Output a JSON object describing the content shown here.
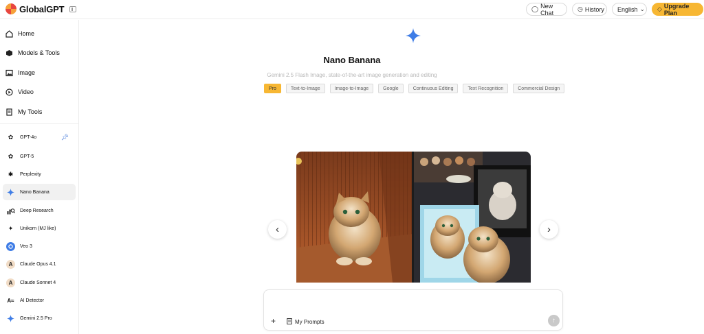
{
  "brand": {
    "name": "GlobalGPT"
  },
  "topbar": {
    "new_chat": "New Chat",
    "history": "History",
    "language": "English",
    "upgrade": "Upgrade Plan"
  },
  "sidebar": {
    "nav": [
      {
        "label": "Home",
        "icon": "home-icon"
      },
      {
        "label": "Models & Tools",
        "icon": "cube-icon"
      },
      {
        "label": "Image",
        "icon": "image-icon"
      },
      {
        "label": "Video",
        "icon": "play-icon"
      },
      {
        "label": "My Tools",
        "icon": "document-icon"
      }
    ],
    "tools": [
      {
        "label": "GPT-4o",
        "icon": "openai-icon",
        "pinned": true
      },
      {
        "label": "GPT-5",
        "icon": "openai-icon"
      },
      {
        "label": "Perplexity",
        "icon": "perplexity-icon"
      },
      {
        "label": "Nano Banana",
        "icon": "sparkle-icon",
        "active": true
      },
      {
        "label": "Deep Research",
        "icon": "research-icon"
      },
      {
        "label": "Unikorn (MJ like)",
        "icon": "unicorn-icon"
      },
      {
        "label": "Veo 3",
        "icon": "veo-icon"
      },
      {
        "label": "Claude Opus 4.1",
        "icon": "claude-icon"
      },
      {
        "label": "Claude Sonnet 4",
        "icon": "claude-icon"
      },
      {
        "label": "AI Detector",
        "icon": "detector-icon"
      },
      {
        "label": "Gemini 2.5 Pro",
        "icon": "gemini-icon"
      }
    ]
  },
  "main": {
    "title": "Nano Banana",
    "subtitle": "Gemini 2.5 Flash Image, state-of-the-art image generation and editing",
    "tags": [
      {
        "label": "Pro",
        "active": true
      },
      {
        "label": "Text-to-Image"
      },
      {
        "label": "Image-to-Image"
      },
      {
        "label": "Google"
      },
      {
        "label": "Continuous Editing"
      },
      {
        "label": "Text Recognition"
      },
      {
        "label": "Commercial Design"
      }
    ]
  },
  "composer": {
    "my_prompts": "My Prompts"
  },
  "colors": {
    "accent": "#f7b733",
    "pin": "#3b73d8",
    "subtitle": "#b8b8b8"
  }
}
